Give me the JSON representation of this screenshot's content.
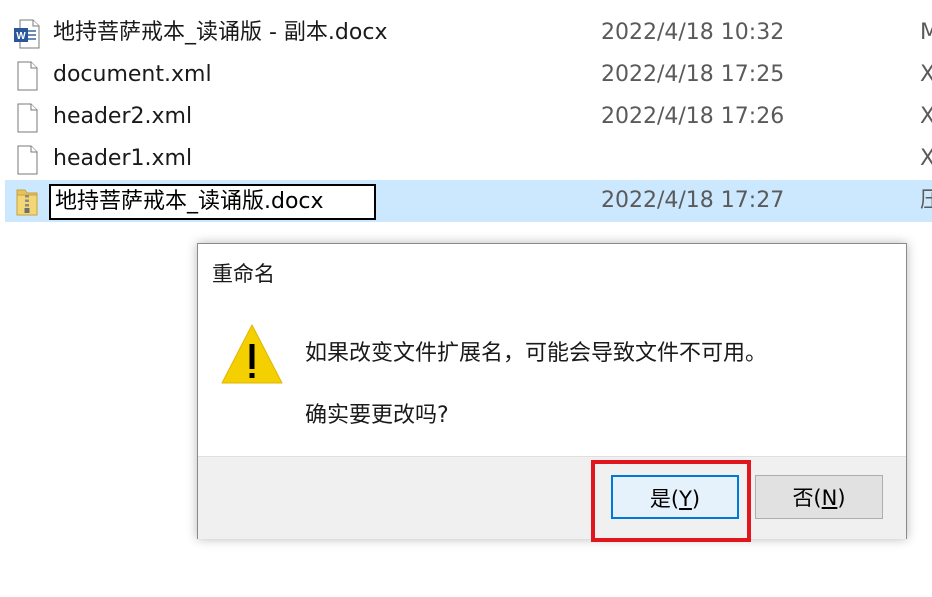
{
  "files": [
    {
      "name": "地持菩萨戒本_读诵版 - 副本.docx",
      "date": "2022/4/18 10:32",
      "type": "M",
      "icon": "word-doc-icon"
    },
    {
      "name": "document.xml",
      "date": "2022/4/18 17:25",
      "type": "X",
      "icon": "blank-file-icon"
    },
    {
      "name": "header2.xml",
      "date": "2022/4/18 17:26",
      "type": "X",
      "icon": "blank-file-icon"
    },
    {
      "name": "header1.xml",
      "date": "",
      "type": "X",
      "icon": "blank-file-icon"
    },
    {
      "name": "地持菩萨戒本_读诵版.docx",
      "date": "2022/4/18 17:27",
      "type": "压",
      "icon": "zip-folder-icon",
      "selected": true,
      "editing": true
    }
  ],
  "dialog": {
    "title": "重命名",
    "message_line1": "如果改变文件扩展名，可能会导致文件不可用。",
    "message_line2": "确实要更改吗?",
    "icon": "warning-icon",
    "yes_label": "是(",
    "yes_key": "Y",
    "yes_close": ")",
    "no_label": "否(",
    "no_key": "N",
    "no_close": ")"
  },
  "colors": {
    "selection": "#cce8ff",
    "accent": "#0078d7",
    "highlight": "#e0161c",
    "warning": "#f5d000"
  }
}
